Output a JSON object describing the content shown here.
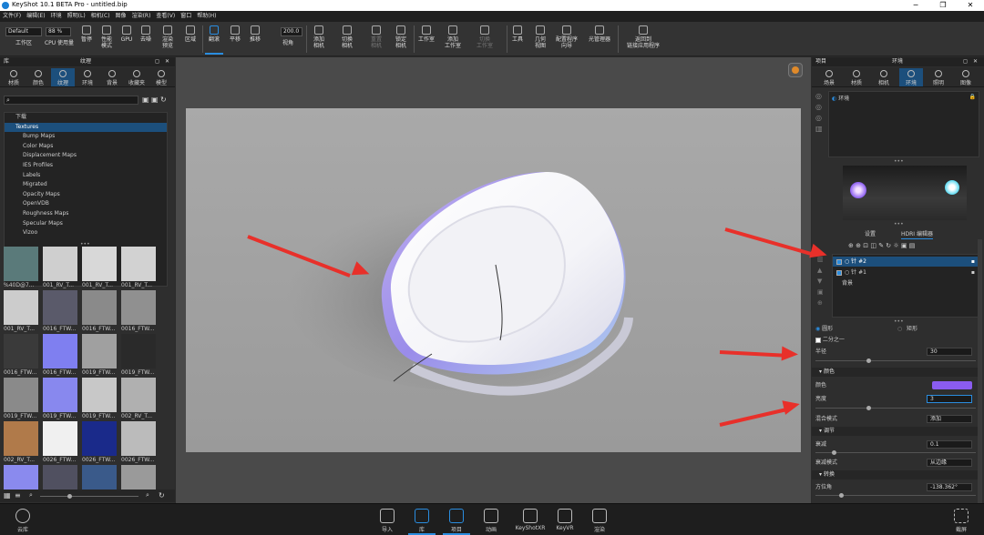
{
  "window": {
    "title": "KeyShot 10.1 BETA Pro  - untitled.bip",
    "controls": [
      "─",
      "❐",
      "✕"
    ]
  },
  "menu": [
    "文件(F)",
    "编辑(E)",
    "环境",
    "照明(L)",
    "相机(C)",
    "图像",
    "渲染(R)",
    "查看(V)",
    "窗口",
    "帮助(H)"
  ],
  "toolbar": {
    "workspace_value": "Default",
    "workspace_label": "工作区",
    "zoom_value": "88 %",
    "cpu_label": "CPU 使用量",
    "pause_label": "暂停",
    "perf_label": "性能\n模式",
    "gpu_label": "GPU",
    "denoise_label": "去噪",
    "render_label": "渲染\n预览",
    "region_label": "区域",
    "tumble_label": "翻滚",
    "pan_label": "平移",
    "dolly_label": "推移",
    "fov_value": "200.0",
    "fov_label": "视角",
    "add_camera_label": "添加\n相机",
    "switch_camera_label": "切换\n相机",
    "reset_camera_label": "重置\n相机",
    "lock_camera_label": "锁定\n相机",
    "studio_label": "工作室",
    "add_studio_label": "添加\n工作室",
    "switch_studio_label": "切换\n工作室",
    "tools_label": "工具",
    "geometry_label": "几何\n视图",
    "configurator_label": "配置程序\n向导",
    "light_manager_label": "光管理器",
    "link_label": "返回到\n链接应用程序"
  },
  "left_panel": {
    "header_left": "库",
    "header_title": "纹理",
    "tabs": [
      "材质",
      "颜色",
      "纹理",
      "环境",
      "背景",
      "收藏夹",
      "模型"
    ],
    "selected_tab": 2,
    "tree": [
      {
        "label": "下载",
        "kind": "root"
      },
      {
        "label": "Textures",
        "kind": "sel"
      },
      {
        "label": "Bump Maps",
        "kind": "child"
      },
      {
        "label": "Color Maps",
        "kind": "child"
      },
      {
        "label": "Displacement Maps",
        "kind": "child"
      },
      {
        "label": "IES Profiles",
        "kind": "child"
      },
      {
        "label": "Labels",
        "kind": "child"
      },
      {
        "label": "Migrated",
        "kind": "child"
      },
      {
        "label": "Opacity Maps",
        "kind": "child"
      },
      {
        "label": "OpenVDB",
        "kind": "child"
      },
      {
        "label": "Roughness Maps",
        "kind": "child"
      },
      {
        "label": "Specular Maps",
        "kind": "child"
      },
      {
        "label": "Vizoo",
        "kind": "child"
      }
    ],
    "thumbs": [
      {
        "label": "%40D@7...",
        "color": "#5a7a7a"
      },
      {
        "label": "001_RV_T...",
        "color": "#cfcfcf"
      },
      {
        "label": "001_RV_T...",
        "color": "#d8d8d8"
      },
      {
        "label": "001_RV_T...",
        "color": "#d2d2d2"
      },
      {
        "label": "001_RV_T...",
        "color": "#cccccc"
      },
      {
        "label": "0016_FTW...",
        "color": "#5a5a6a"
      },
      {
        "label": "0016_FTW...",
        "color": "#8a8a8a"
      },
      {
        "label": "0016_FTW...",
        "color": "#909090"
      },
      {
        "label": "0016_FTW...",
        "color": "#3a3a3a"
      },
      {
        "label": "0016_FTW...",
        "color": "#7f7ff0"
      },
      {
        "label": "0019_FTW...",
        "color": "#a0a0a0"
      },
      {
        "label": "0019_FTW...",
        "color": "#2a2a2a"
      },
      {
        "label": "0019_FTW...",
        "color": "#8a8a8a"
      },
      {
        "label": "0019_FTW...",
        "color": "#8888ee"
      },
      {
        "label": "0019_FTW...",
        "color": "#c8c8c8"
      },
      {
        "label": "002_RV_T...",
        "color": "#b0b0b0"
      },
      {
        "label": "002_RV_T...",
        "color": "#b07a4a"
      },
      {
        "label": "0026_FTW...",
        "color": "#f0f0f0"
      },
      {
        "label": "0026_FTW...",
        "color": "#1a2a8a"
      },
      {
        "label": "0026_FTW...",
        "color": "#bbbbbb"
      },
      {
        "label": "",
        "color": "#8a8aee"
      },
      {
        "label": "",
        "color": "#505060"
      },
      {
        "label": "",
        "color": "#3a5a8a"
      },
      {
        "label": "",
        "color": "#9a9a9a"
      }
    ]
  },
  "right_panel": {
    "header_left": "项目",
    "header_title": "环境",
    "tabs": [
      "场景",
      "材质",
      "相机",
      "环境",
      "照明",
      "图像"
    ],
    "selected_tab": 3,
    "env_item": "环境",
    "subtabs": [
      "设置",
      "HDRI 编辑器"
    ],
    "selected_subtab": 1,
    "pins": [
      {
        "label": "针 #2",
        "selected": true
      },
      {
        "label": "针 #1",
        "selected": false
      }
    ],
    "background_label": "背景",
    "shape_circle": "圆形",
    "shape_rect": "矩形",
    "half_label": "二分之一",
    "radius_label": "半径",
    "radius_value": "30",
    "section_color": "颜色",
    "color_label": "颜色",
    "color_value": "#8a5cf0",
    "brightness_label": "亮度",
    "brightness_value": "3",
    "blend_label": "混合模式",
    "blend_value": "添加",
    "section_adjust": "调节",
    "falloff_label": "衰减",
    "falloff_value": "0.1",
    "falloff_mode_label": "衰减模式",
    "falloff_mode_value": "从边缘",
    "section_transform": "转换",
    "azimuth_label": "方位角",
    "azimuth_value": "-138.362°"
  },
  "statusbar": {
    "cloud_label": "云库",
    "items": [
      "导入",
      "库",
      "项目",
      "动画",
      "KeyShotXR",
      "KeyVR",
      "渲染"
    ],
    "selected_items": [
      1,
      2
    ],
    "screenshot_label": "截屏"
  }
}
